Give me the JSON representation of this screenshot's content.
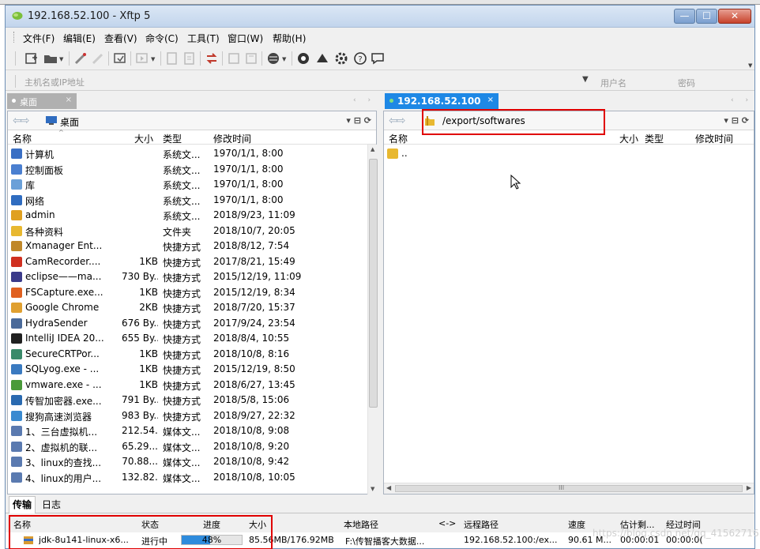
{
  "window": {
    "title": "192.168.52.100   - Xftp 5",
    "btn_min": "—",
    "btn_max": "☐",
    "btn_close": "✕"
  },
  "menu": [
    "文件(F)",
    "编辑(E)",
    "查看(V)",
    "命令(C)",
    "工具(T)",
    "窗口(W)",
    "帮助(H)"
  ],
  "address": {
    "host_placeholder": "主机名或IP地址",
    "user_placeholder": "用户名",
    "password_placeholder": "密码"
  },
  "left_tab": {
    "label": "桌面",
    "close": "×"
  },
  "right_tab": {
    "label": "192.168.52.100",
    "close": "×"
  },
  "left_pane": {
    "path": "桌面",
    "columns": {
      "name": "名称",
      "size": "大小",
      "type": "类型",
      "modified": "修改时间"
    },
    "files": [
      {
        "name": "计算机",
        "size": "",
        "type": "系统文...",
        "time": "1970/1/1, 8:00",
        "color": "#3a6fc4"
      },
      {
        "name": "控制面板",
        "size": "",
        "type": "系统文...",
        "time": "1970/1/1, 8:00",
        "color": "#4a7fd0"
      },
      {
        "name": "库",
        "size": "",
        "type": "系统文...",
        "time": "1970/1/1, 8:00",
        "color": "#6aa0d8"
      },
      {
        "name": "网络",
        "size": "",
        "type": "系统文...",
        "time": "1970/1/1, 8:00",
        "color": "#2f6cc0"
      },
      {
        "name": "admin",
        "size": "",
        "type": "系统文...",
        "time": "2018/9/23, 11:09",
        "color": "#e0a020"
      },
      {
        "name": "各种资料",
        "size": "",
        "type": "文件夹",
        "time": "2018/10/7, 20:05",
        "color": "#e8b830"
      },
      {
        "name": "Xmanager Ent...",
        "size": "",
        "type": "快捷方式",
        "time": "2018/8/12, 7:54",
        "color": "#c0882a"
      },
      {
        "name": "CamRecorder....",
        "size": "1KB",
        "type": "快捷方式",
        "time": "2017/8/21, 15:49",
        "color": "#d03020"
      },
      {
        "name": "eclipse——ma...",
        "size": "730 By...",
        "type": "快捷方式",
        "time": "2015/12/19, 11:09",
        "color": "#3a3a8a"
      },
      {
        "name": "FSCapture.exe...",
        "size": "1KB",
        "type": "快捷方式",
        "time": "2015/12/19, 8:34",
        "color": "#e06020"
      },
      {
        "name": "Google Chrome",
        "size": "2KB",
        "type": "快捷方式",
        "time": "2018/7/20, 15:37",
        "color": "#e0a030"
      },
      {
        "name": "HydraSender",
        "size": "676 By...",
        "type": "快捷方式",
        "time": "2017/9/24, 23:54",
        "color": "#4a6a9a"
      },
      {
        "name": "IntelliJ IDEA 20...",
        "size": "655 By...",
        "type": "快捷方式",
        "time": "2018/8/4, 10:55",
        "color": "#202020"
      },
      {
        "name": "SecureCRTPor...",
        "size": "1KB",
        "type": "快捷方式",
        "time": "2018/10/8, 8:16",
        "color": "#3a8a6a"
      },
      {
        "name": "SQLyog.exe - ...",
        "size": "1KB",
        "type": "快捷方式",
        "time": "2015/12/19, 8:50",
        "color": "#3a7ac0"
      },
      {
        "name": "vmware.exe - ...",
        "size": "1KB",
        "type": "快捷方式",
        "time": "2018/6/27, 13:45",
        "color": "#4a9a3a"
      },
      {
        "name": "传智加密器.exe...",
        "size": "791 By...",
        "type": "快捷方式",
        "time": "2018/5/8, 15:06",
        "color": "#2a6ab0"
      },
      {
        "name": "搜狗高速浏览器",
        "size": "983 By...",
        "type": "快捷方式",
        "time": "2018/9/27, 22:32",
        "color": "#3a8ad0"
      },
      {
        "name": "1、三台虚拟机...",
        "size": "212.54...",
        "type": "媒体文...",
        "time": "2018/10/8, 9:08",
        "color": "#5a7ab0"
      },
      {
        "name": "2、虚拟机的联...",
        "size": "65.29...",
        "type": "媒体文...",
        "time": "2018/10/8, 9:20",
        "color": "#5a7ab0"
      },
      {
        "name": "3、linux的查找...",
        "size": "70.88...",
        "type": "媒体文...",
        "time": "2018/10/8, 9:42",
        "color": "#5a7ab0"
      },
      {
        "name": "4、linux的用户...",
        "size": "132.82...",
        "type": "媒体文...",
        "time": "2018/10/8, 10:05",
        "color": "#5a7ab0"
      }
    ]
  },
  "right_pane": {
    "path": "/export/softwares",
    "columns": {
      "name": "名称",
      "size": "大小",
      "type": "类型",
      "modified": "修改时间"
    },
    "files": [
      {
        "name": "..",
        "color": "#e8b830"
      }
    ],
    "hscroll_mark": "III"
  },
  "transfer": {
    "tabs": [
      "传输",
      "日志"
    ],
    "columns": {
      "name": "名称",
      "status": "状态",
      "progress": "进度",
      "size": "大小",
      "local": "本地路径",
      "dir": "<->",
      "remote": "远程路径",
      "speed": "速度",
      "remaining": "估计剩...",
      "elapsed": "经过时间"
    },
    "row": {
      "name": "jdk-8u141-linux-x6...",
      "status": "进行中",
      "progress_pct": 48,
      "progress_label": "48%",
      "size": "85.56MB/176.92MB",
      "local": "F:\\传智播客大数据...",
      "remote": "192.168.52.100:/ex...",
      "speed": "90.61 M...",
      "remaining": "00:00:01",
      "elapsed": "00:00:0("
    }
  },
  "watermark": "https://blog.csdn.net/qq_41562716"
}
